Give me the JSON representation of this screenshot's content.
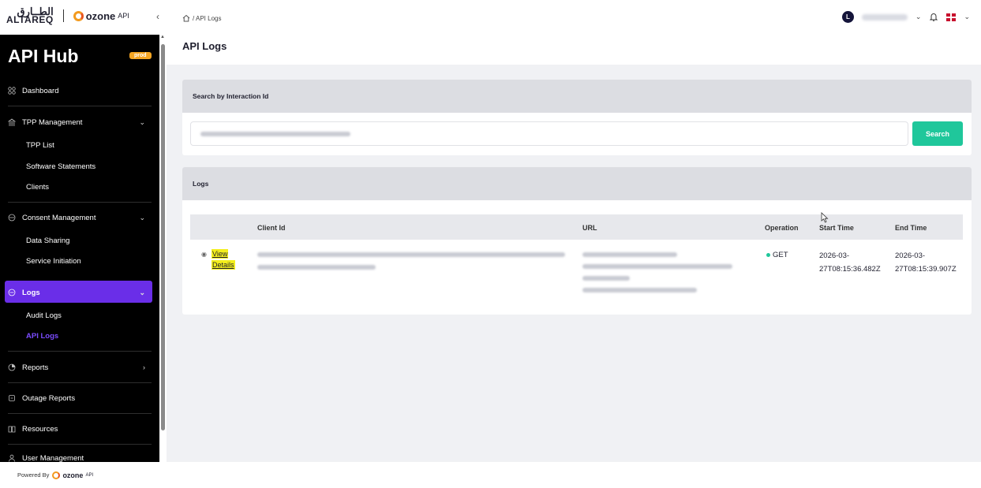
{
  "brand": {
    "altareq_arabic": "الطــارق",
    "altareq_latin": "ALTAREQ",
    "ozone_word": "ozone",
    "ozone_api": "API"
  },
  "breadcrumb": {
    "path": "/ API Logs"
  },
  "user": {
    "avatar_initial": "L"
  },
  "sidebar": {
    "title": "API Hub",
    "env_badge": "prod",
    "items": [
      {
        "label": "Dashboard",
        "icon": "dashboard-icon"
      },
      {
        "label": "TPP Management",
        "icon": "bank-icon"
      },
      {
        "label": "Consent Management",
        "icon": "consent-icon"
      },
      {
        "label": "Logs",
        "icon": "logs-icon"
      },
      {
        "label": "Reports",
        "icon": "reports-icon"
      },
      {
        "label": "Outage Reports",
        "icon": "outage-icon"
      },
      {
        "label": "Resources",
        "icon": "resources-icon"
      },
      {
        "label": "User Management",
        "icon": "user-icon"
      }
    ],
    "tpp_sub": [
      "TPP List",
      "Software Statements",
      "Clients"
    ],
    "consent_sub": [
      "Data Sharing",
      "Service Initiation"
    ],
    "logs_sub": [
      "Audit Logs",
      "API Logs"
    ],
    "active_color": "#6a2ee8"
  },
  "page": {
    "title": "API Logs"
  },
  "search_card": {
    "title": "Search by Interaction Id",
    "button": "Search"
  },
  "logs_card": {
    "title": "Logs",
    "columns": [
      "Client Id",
      "URL",
      "Operation",
      "Start Time",
      "End Time"
    ],
    "row": {
      "view_1": "View",
      "view_2": "Details",
      "operation": "GET",
      "start_1": "2026-03-",
      "start_2": "27T08:15:36.482Z",
      "end_1": "2026-03-",
      "end_2": "27T08:15:39.907Z"
    }
  },
  "footer": {
    "powered_by": "Powered By",
    "ozone_word": "ozone",
    "ozone_api": "API"
  },
  "colors": {
    "accent": "#1fc79b",
    "sidebar": "#000000",
    "highlight": "#f3ee1c"
  }
}
